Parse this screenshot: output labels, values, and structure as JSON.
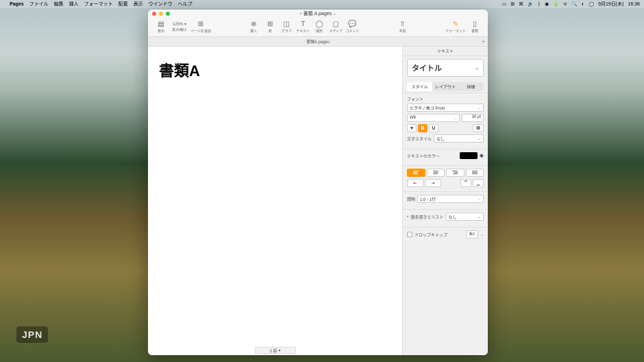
{
  "menubar": {
    "app": "Pages",
    "items": [
      "ファイル",
      "編集",
      "挿入",
      "フォーマット",
      "配置",
      "表示",
      "ウインドウ",
      "ヘルプ"
    ],
    "date": "9月19日(木)",
    "time": "16:36"
  },
  "window": {
    "title": "書類 A.pages",
    "tab": "書類A.pages"
  },
  "toolbar": {
    "view": "表示",
    "zoom": "125% ▾",
    "zoom_lbl": "拡大/縮小",
    "addpage": "ページを追加",
    "insert": "挿入",
    "table": "表",
    "chart": "グラフ",
    "text": "テキスト",
    "shape": "図形",
    "media": "メディア",
    "comment": "コメント",
    "share": "共有",
    "format": "フォーマット",
    "document": "書類"
  },
  "document": {
    "title": "書類A"
  },
  "sidebar": {
    "header": "テキスト",
    "paragraph_style": "タイトル",
    "tabs": [
      "スタイル",
      "レイアウト",
      "詳細"
    ],
    "font_label": "フォント",
    "font_family": "ヒラギノ角ゴ ProN",
    "font_weight": "W6",
    "font_size": "30 pt",
    "bold": "B",
    "underline": "U",
    "char_style_label": "文字スタイル",
    "char_style_value": "なし",
    "text_color_label": "テキストのカラー",
    "spacing_label": "間隔",
    "spacing_value": "1.0 - 1行",
    "bullets_label": "箇条書きとリスト",
    "bullets_value": "なし",
    "dropcap_label": "ドロップキャップ"
  },
  "statusbar": {
    "words": "3 語"
  },
  "overlay": "JPN"
}
